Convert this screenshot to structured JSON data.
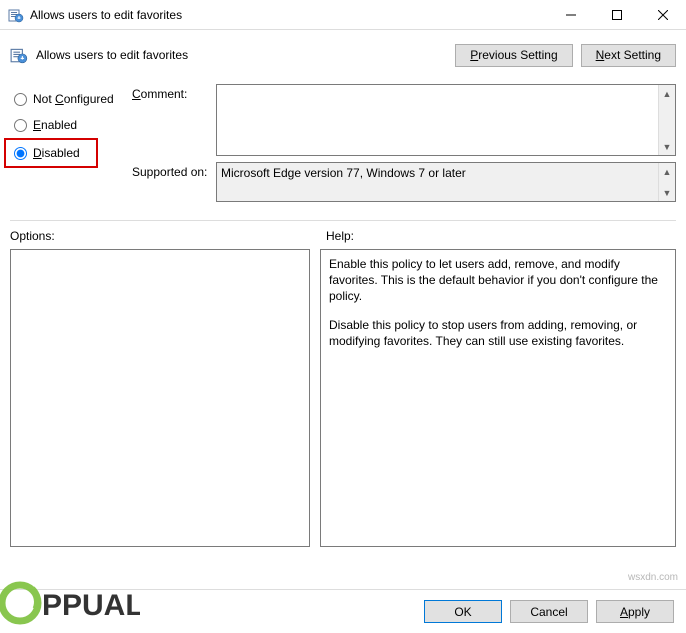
{
  "window": {
    "title": "Allows users to edit favorites"
  },
  "header": {
    "title": "Allows users to edit favorites",
    "prev_btn": "Previous Setting",
    "next_btn": "Next Setting"
  },
  "state": {
    "not_configured_label": "Not Configured",
    "enabled_label": "Enabled",
    "disabled_label": "Disabled",
    "selected": "disabled"
  },
  "fields": {
    "comment_label": "Comment:",
    "comment_value": "",
    "supported_label": "Supported on:",
    "supported_value": "Microsoft Edge version 77, Windows 7 or later"
  },
  "lower": {
    "options_label": "Options:",
    "help_label": "Help:",
    "help_p1": "Enable this policy to let users add, remove, and modify favorites. This is the default behavior if you don't configure the policy.",
    "help_p2": "Disable this policy to stop users from adding, removing, or modifying favorites. They can still use existing favorites."
  },
  "footer": {
    "ok": "OK",
    "cancel": "Cancel",
    "apply": "Apply"
  },
  "watermark": {
    "right": "wsxdn.com"
  }
}
